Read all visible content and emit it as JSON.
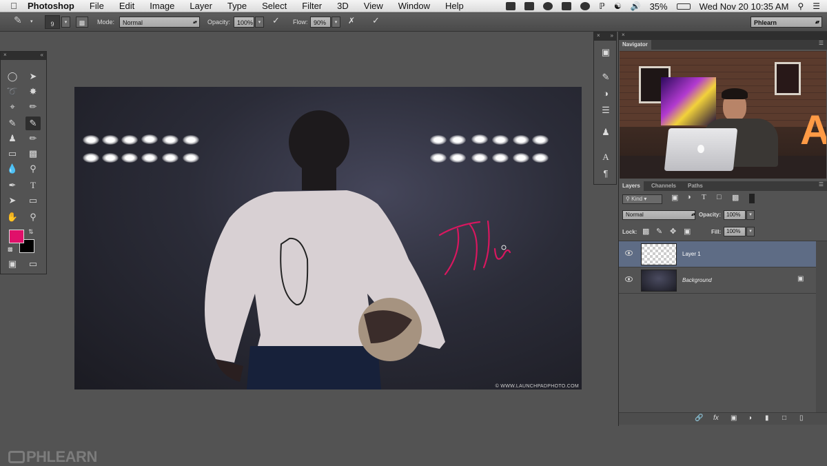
{
  "menubar": {
    "app_name": "Photoshop",
    "items": [
      "File",
      "Edit",
      "Image",
      "Layer",
      "Type",
      "Select",
      "Filter",
      "3D",
      "View",
      "Window",
      "Help"
    ],
    "battery": "35%",
    "clock": "Wed Nov 20  10:35 AM"
  },
  "options_bar": {
    "brush_size": "9",
    "mode_label": "Mode:",
    "mode_value": "Normal",
    "opacity_label": "Opacity:",
    "opacity_value": "100%",
    "flow_label": "Flow:",
    "flow_value": "90%",
    "workspace": "Phlearn"
  },
  "tools": {
    "foreground_color": "#e0106a",
    "background_color": "#000000",
    "active": "brush"
  },
  "canvas": {
    "watermark": "© WWW.LAUNCHPADPHOTO.COM",
    "handwriting": "Blu",
    "handwriting_color": "#d8175f"
  },
  "navigator": {
    "tab": "Navigator"
  },
  "layers_panel": {
    "tabs": [
      "Layers",
      "Channels",
      "Paths"
    ],
    "filter_label": "Kind",
    "blend_mode": "Normal",
    "opacity_label": "Opacity:",
    "opacity_value": "100%",
    "lock_label": "Lock:",
    "fill_label": "Fill:",
    "fill_value": "100%",
    "layers": [
      {
        "name": "Layer 1",
        "selected": true
      },
      {
        "name": "Background",
        "selected": false,
        "locked": true
      }
    ]
  },
  "branding": {
    "logo_text": "PHLEARN"
  }
}
